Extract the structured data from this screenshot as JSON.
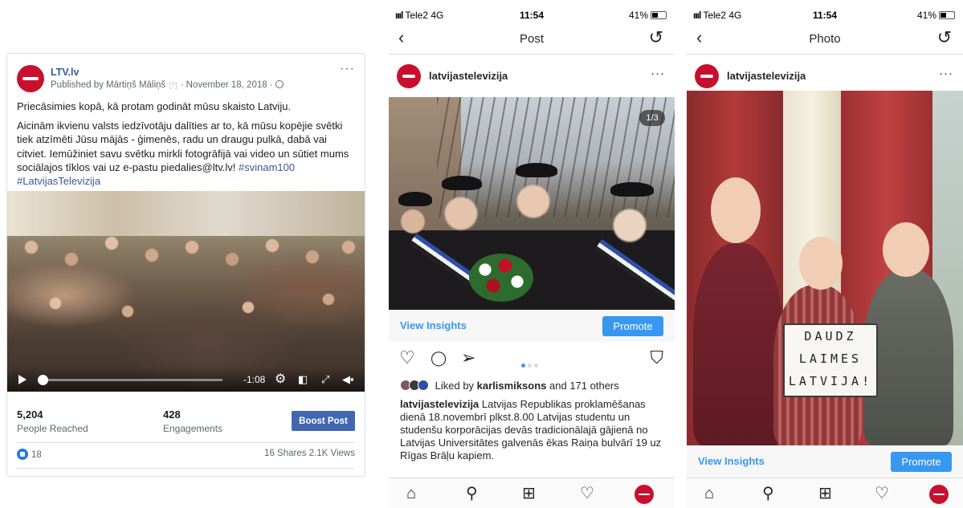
{
  "facebook": {
    "page_name": "LTV.lv",
    "published_by": "Published by Mārtiņš Māliņš",
    "published_q": "[?]",
    "published_date": "· November 18, 2018 ·",
    "more": "···",
    "text_line1": "Priecāsimies kopā, kā protam godināt mūsu skaisto Latviju.",
    "text_body": "Aicinām ikvienu valsts iedzīvotāju dalīties ar to, kā mūsu kopējie svētki tiek atzīmēti Jūsu mājās - ģimenēs, radu un draugu pulkā, dabā vai citviet. Iemūžiniet savu svētku mirkli fotogrāfijā vai video un sūtiet mums sociālajos tīklos vai uz e-pastu piedalies@ltv.lv!",
    "hashtag1": "#svinam100",
    "hashtag2": "#LatvijasTelevizija",
    "video_time": "-1:08",
    "people_reached_value": "5,204",
    "people_reached_label": "People Reached",
    "engagements_value": "428",
    "engagements_label": "Engagements",
    "boost_label": "Boost Post",
    "likes_count": "18",
    "shares_views": "16 Shares  2.1K Views"
  },
  "post_screen": {
    "carrier": "Tele2  4G",
    "signal": "ıııl",
    "time": "11:54",
    "battery": "41%",
    "nav_title": "Post",
    "back": "‹",
    "refresh": "↺",
    "handle": "latvijastelevizija",
    "more": "···",
    "counter": "1/3",
    "view_insights": "View Insights",
    "promote": "Promote",
    "liked_prefix": "Liked by",
    "liked_user": "karlismiksons",
    "liked_suffix": "and 171 others",
    "caption_user": "latvijastelevizija",
    "caption": "Latvijas Republikas proklamēšanas dienā 18.novembrī plkst.8.00 Latvijas studentu un studenšu korporācijas devās tradicionālajā gājienā no Latvijas Universitātes galvenās ēkas Raiņa bulvārī 19 uz Rīgas Brāļu kapiem.",
    "icons": {
      "heart": "♡",
      "comment": "◯",
      "share": "➢",
      "save": "⛉"
    }
  },
  "photo_screen": {
    "carrier": "Tele2  4G",
    "signal": "ıııl",
    "time": "11:54",
    "battery": "41%",
    "nav_title": "Photo",
    "back": "‹",
    "refresh": "↺",
    "handle": "latvijastelevizija",
    "more": "···",
    "sign_line1": "DAUDZ",
    "sign_line2": "LAIMES",
    "sign_line3": "LATVIJA!",
    "view_insights": "View Insights",
    "promote": "Promote"
  },
  "tabbar_icons": {
    "home": "⌂",
    "search": "⚲",
    "add": "⊞",
    "activity": "♡"
  },
  "colors": {
    "facebook_blue": "#4267b2",
    "instagram_blue": "#3897f0",
    "ltv_red": "#c8102e"
  }
}
